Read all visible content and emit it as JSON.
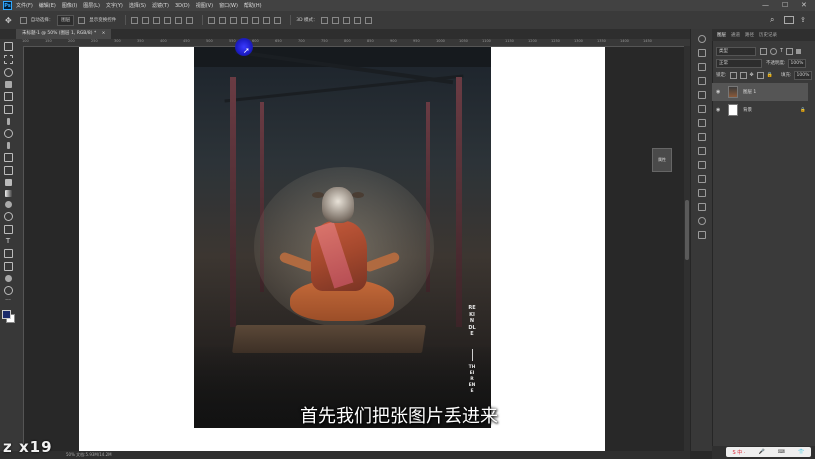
{
  "app": {
    "logo_text": "Ps"
  },
  "menubar": {
    "items": [
      "文件(F)",
      "编辑(E)",
      "图像(I)",
      "图层(L)",
      "文字(Y)",
      "选择(S)",
      "滤镜(T)",
      "3D(D)",
      "视图(V)",
      "窗口(W)",
      "帮助(H)"
    ],
    "minimize": "—",
    "maximize": "☐",
    "close": "✕"
  },
  "options": {
    "auto_select_label": "自动选择：",
    "auto_select_value": "图层",
    "show_transform_label": "显示变换控件",
    "mode_label": "3D 模式："
  },
  "document": {
    "tab_title": "未标题-1 @ 50% (图层 1, RGB/8) *",
    "ruler_marks": [
      "100",
      "150",
      "200",
      "250",
      "300",
      "350",
      "400",
      "450",
      "500",
      "550",
      "600",
      "650",
      "700",
      "750",
      "800",
      "850",
      "900",
      "950",
      "1000",
      "1050",
      "1100",
      "1150",
      "1200",
      "1250",
      "1300",
      "1350",
      "1400",
      "1450"
    ]
  },
  "poster": {
    "vertical_text_1": "REKINDLE",
    "vertical_text_2": "THEIR ENE"
  },
  "subtitle": "首先我们把张图片丢进来",
  "watermark": "z  x19",
  "status": {
    "zoom": "50%",
    "doc_info": "文档:5.93M/14.2M"
  },
  "props_mini": {
    "label": "属性"
  },
  "layers_panel": {
    "tabs": [
      "图层",
      "通道",
      "路径",
      "历史记录"
    ],
    "kind_label": "类型",
    "blend_mode": "正常",
    "opacity_label": "不透明度:",
    "opacity_value": "100%",
    "lock_label": "锁定:",
    "fill_label": "填充:",
    "fill_value": "100%",
    "layers": [
      {
        "name": "图层 1",
        "selected": true,
        "visible": true
      },
      {
        "name": "背景",
        "selected": false,
        "visible": true,
        "locked": true
      }
    ]
  },
  "ime": {
    "label": "S 中 ·"
  },
  "colors": {
    "accent": "#31a8ff",
    "panel_bg": "#3a3a3a",
    "workspace_bg": "#282828",
    "selected_layer": "#555555"
  }
}
